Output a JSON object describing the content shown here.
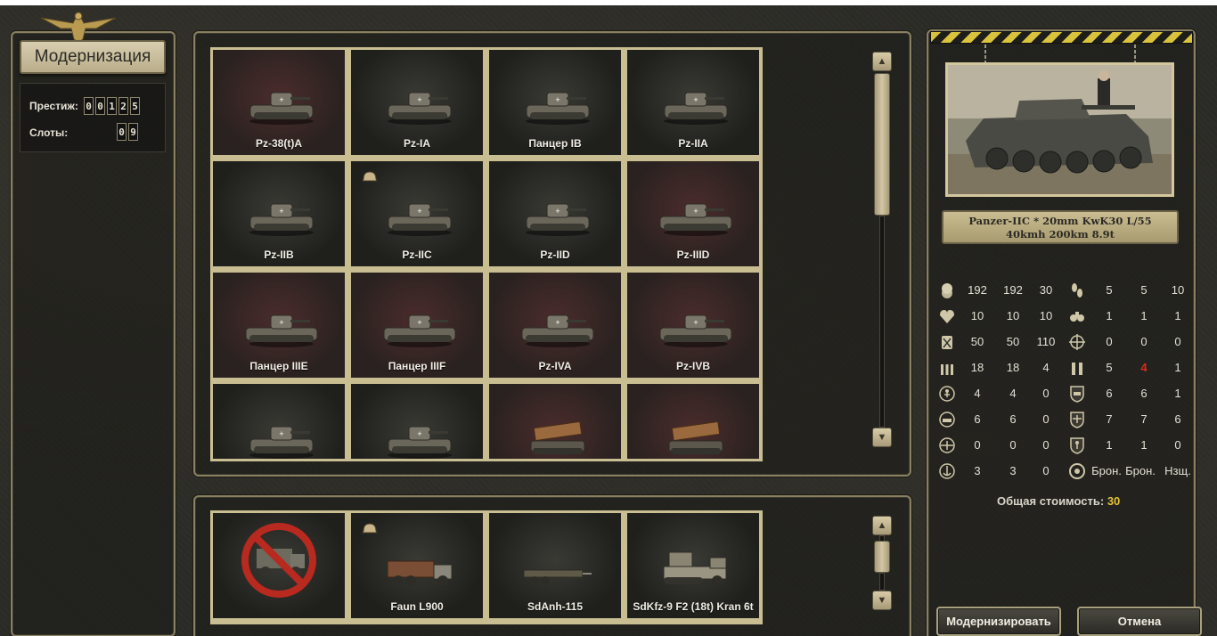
{
  "header": {
    "title": "Модернизация"
  },
  "stats": {
    "prestige_label": "Престиж:",
    "prestige_digits": [
      "0",
      "0",
      "1",
      "2",
      "5"
    ],
    "slots_label": "Слоты:",
    "slots_digits": [
      "0",
      "9"
    ]
  },
  "units": [
    {
      "label": "Pz-38(t)A",
      "bg": "red"
    },
    {
      "label": "Pz-IA",
      "bg": "dark"
    },
    {
      "label": "Панцер IB",
      "bg": "dark"
    },
    {
      "label": "Pz-IIA",
      "bg": "dark"
    },
    {
      "label": "Pz-IIB",
      "bg": "dark"
    },
    {
      "label": "Pz-IIC",
      "bg": "dark"
    },
    {
      "label": "Pz-IID",
      "bg": "dark"
    },
    {
      "label": "Pz-IIID",
      "bg": "red"
    },
    {
      "label": "Панцер IIIE",
      "bg": "red"
    },
    {
      "label": "Панцер IIIF",
      "bg": "red"
    },
    {
      "label": "Pz-IVA",
      "bg": "red"
    },
    {
      "label": "Pz-IVB",
      "bg": "red"
    },
    {
      "label": "",
      "bg": "dark"
    },
    {
      "label": "",
      "bg": "dark"
    },
    {
      "label": "",
      "bg": "red"
    },
    {
      "label": "",
      "bg": "red"
    }
  ],
  "transports": [
    {
      "label": ""
    },
    {
      "label": "Faun L900"
    },
    {
      "label": "SdAnh-115"
    },
    {
      "label": "SdKfz-9 F2 (18t) Kran 6t"
    }
  ],
  "selected": {
    "desc_line1": "Panzer-IIC * 20mm KwK30 L/55",
    "desc_line2": "40kmh 200km 8.9t"
  },
  "specs": [
    {
      "icon": "coins-icon",
      "a": "192",
      "b": "192",
      "c": "30",
      "icon2": "footprints-icon",
      "d": "5",
      "e": "5",
      "f": "10"
    },
    {
      "icon": "heart-icon",
      "a": "10",
      "b": "10",
      "c": "10",
      "icon2": "binoculars-icon",
      "d": "1",
      "e": "1",
      "f": "1"
    },
    {
      "icon": "fuel-icon",
      "a": "50",
      "b": "50",
      "c": "110",
      "icon2": "crosshair-icon",
      "d": "0",
      "e": "0",
      "f": "0"
    },
    {
      "icon": "ammo-icon",
      "a": "18",
      "b": "18",
      "c": "4",
      "icon2": "shells-icon",
      "d": "5",
      "e": "4",
      "f": "1",
      "e_red": true
    },
    {
      "icon": "soft-attack-icon",
      "a": "4",
      "b": "4",
      "c": "0",
      "icon2": "tank-defense-icon",
      "d": "6",
      "e": "6",
      "f": "1"
    },
    {
      "icon": "hard-attack-icon",
      "a": "6",
      "b": "6",
      "c": "0",
      "icon2": "air-defense-icon",
      "d": "7",
      "e": "7",
      "f": "6"
    },
    {
      "icon": "air-attack-icon",
      "a": "0",
      "b": "0",
      "c": "0",
      "icon2": "infantry-defense-icon",
      "d": "1",
      "e": "1",
      "f": "0"
    },
    {
      "icon": "naval-attack-icon",
      "a": "3",
      "b": "3",
      "c": "0",
      "icon2": "target-icon",
      "d": "Брон.",
      "e": "Брон.",
      "f": "Нзщ."
    }
  ],
  "total": {
    "label": "Общая стоимость:",
    "value": "30"
  },
  "buttons": {
    "upgrade": "Модернизировать",
    "cancel": "Отмена"
  },
  "colors": {
    "gold": "#e6c23a",
    "red": "#e02a1c",
    "frame": "#c9bd92"
  }
}
